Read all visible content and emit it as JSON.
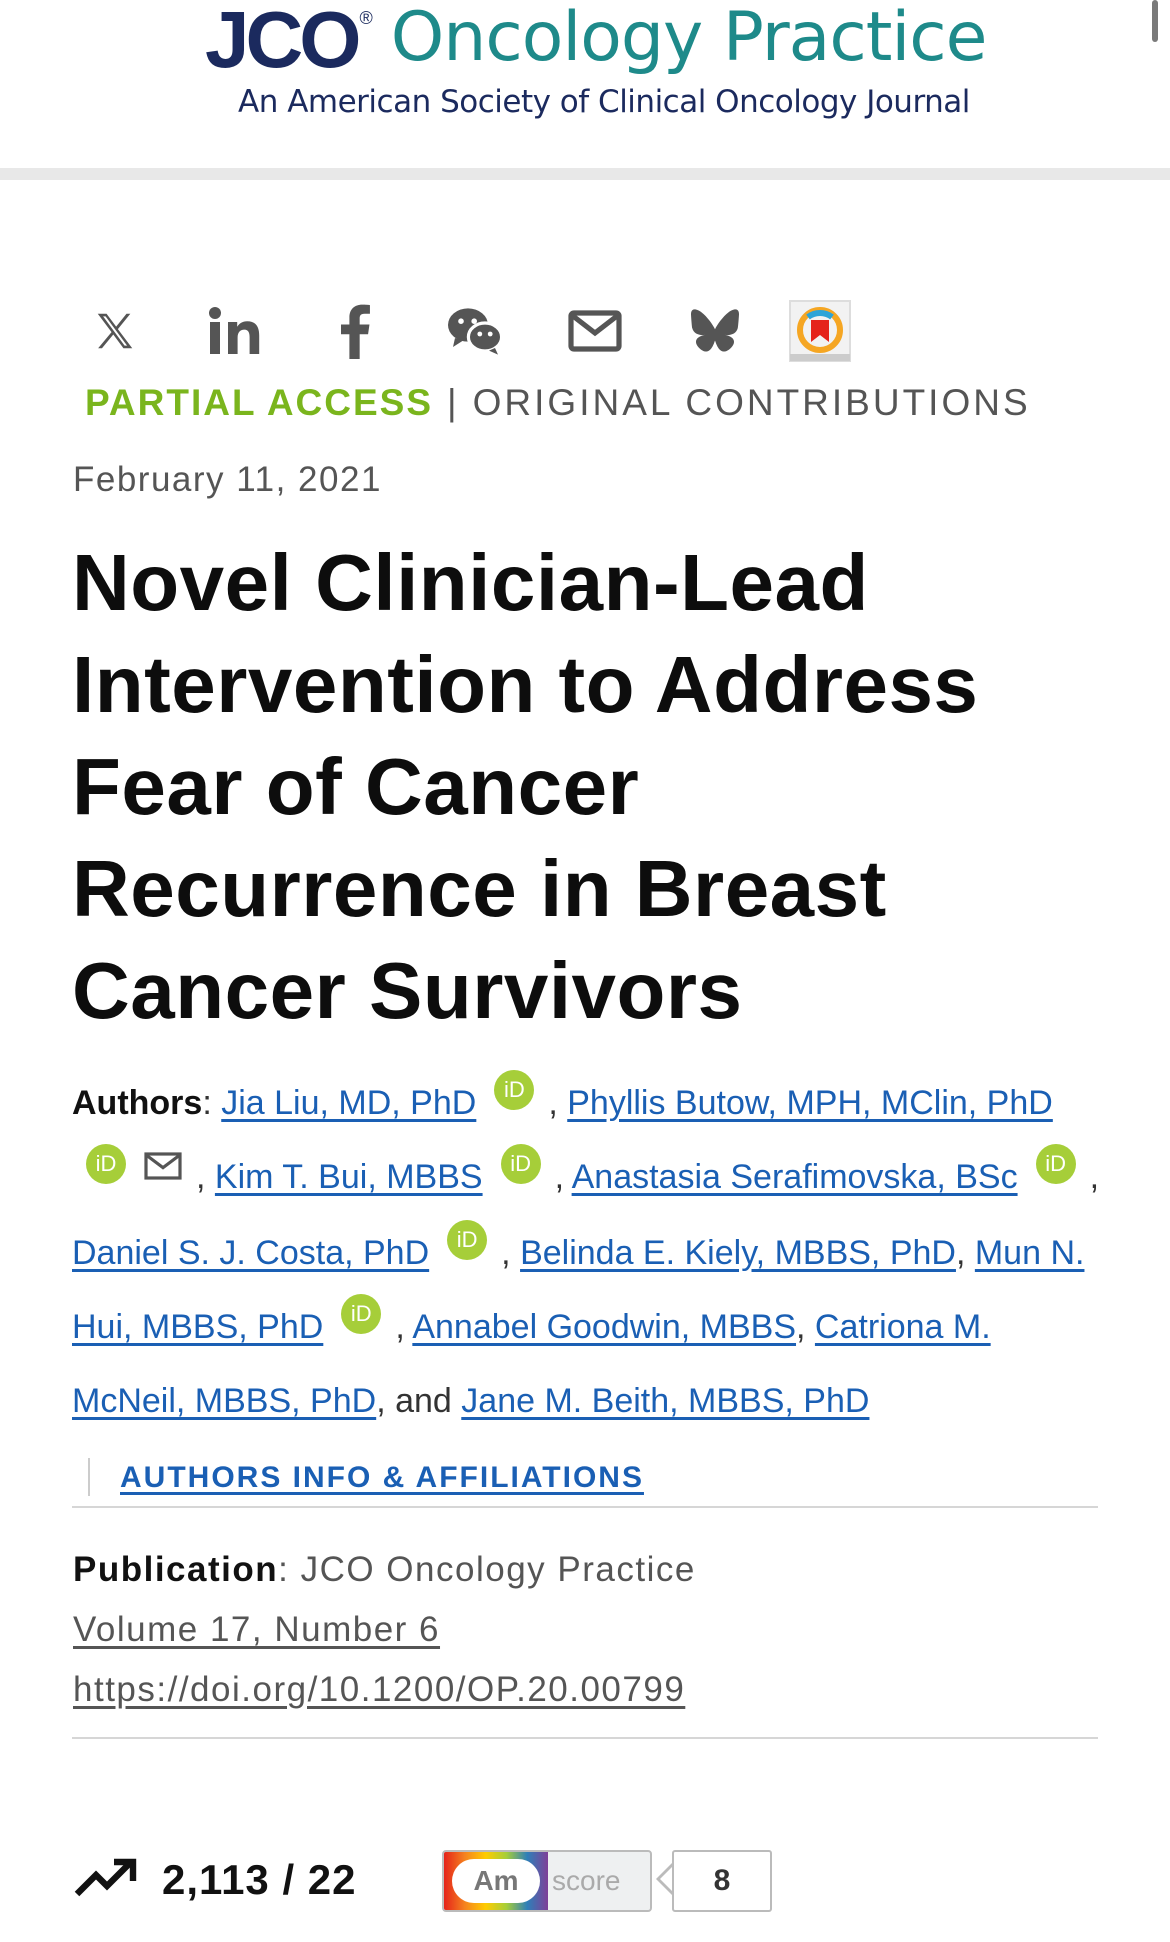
{
  "header": {
    "logo_acronym": "JCO",
    "logo_registered": "®",
    "journal_name": "Oncology Practice",
    "journal_subtitle": "An American Society of Clinical Oncology Journal"
  },
  "share": {
    "icons": [
      "x-icon",
      "linkedin-icon",
      "facebook-icon",
      "wechat-icon",
      "email-icon",
      "bluesky-icon",
      "mendeley-icon"
    ]
  },
  "article": {
    "access": "PARTIAL ACCESS",
    "separator": "|",
    "category": "ORIGINAL CONTRIBUTIONS",
    "date": "February 11, 2021",
    "title": "Novel Clinician-Lead Intervention to Address Fear of Cancer Recurrence in Breast Cancer Survivors"
  },
  "authors": {
    "label": "Authors",
    "list": [
      "Jia Liu, MD, PhD",
      "Phyllis Butow, MPH, MClin, PhD",
      "Kim T. Bui, MBBS",
      "Anastasia Serafimovska, BSc",
      "Daniel S. J. Costa, PhD",
      "Belinda E. Kiely, MBBS, PhD",
      "Mun N. Hui, MBBS, PhD",
      "Annabel Goodwin, MBBS",
      "Catriona M. McNeil, MBBS, PhD",
      "Jane M. Beith, MBBS, PhD"
    ],
    "orcid": "iD",
    "and": "and",
    "affiliations_link": "AUTHORS INFO & AFFILIATIONS"
  },
  "publication": {
    "label": "Publication",
    "journal": "JCO Oncology Practice",
    "volume": "Volume 17, Number 6",
    "doi": "https://doi.org/10.1200/OP.20.00799"
  },
  "metrics": {
    "counts": "2,113 / 22",
    "altmetric_label": "Am",
    "altmetric_score_label": "score",
    "altmetric_score": "8"
  },
  "colors": {
    "brand_navy": "#1b2a5e",
    "brand_teal": "#1e8a8a",
    "access_green": "#7ab51d",
    "link_blue": "#1a5fb4",
    "orcid_green": "#a6ce39"
  }
}
